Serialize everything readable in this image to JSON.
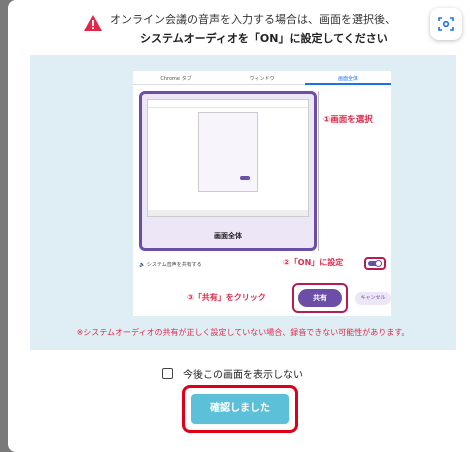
{
  "header": {
    "line1": "オンライン会議の音声を入力する場合は、画面を選択後、",
    "line2": "システムオーディオを「ON」に設定してください",
    "warning_icon": "warning-triangle-icon",
    "camera_icon": "screenshot-icon",
    "accent": "#e0294a"
  },
  "preview": {
    "tabs": [
      "Chrome タブ",
      "ウィンドウ",
      "画面全体"
    ],
    "active_tab": "画面全体",
    "frame_caption": "画面全体",
    "audio_label": "システム音声を共有する",
    "share_label": "共有",
    "cancel_label": "キャンセル",
    "step1": "①画面を選択",
    "step2": "②「ON」に設定",
    "step3": "③「共有」をクリック",
    "toggle_on": true,
    "primary_color": "#6b4ea6"
  },
  "note": "※システムオーディオの共有が正しく設定していない場合、録音できない可能性があります。",
  "footer": {
    "dont_show_label": "今後この画面を表示しない",
    "dont_show_checked": false,
    "confirm_label": "確認しました",
    "confirm_color": "#5bc0d8"
  }
}
